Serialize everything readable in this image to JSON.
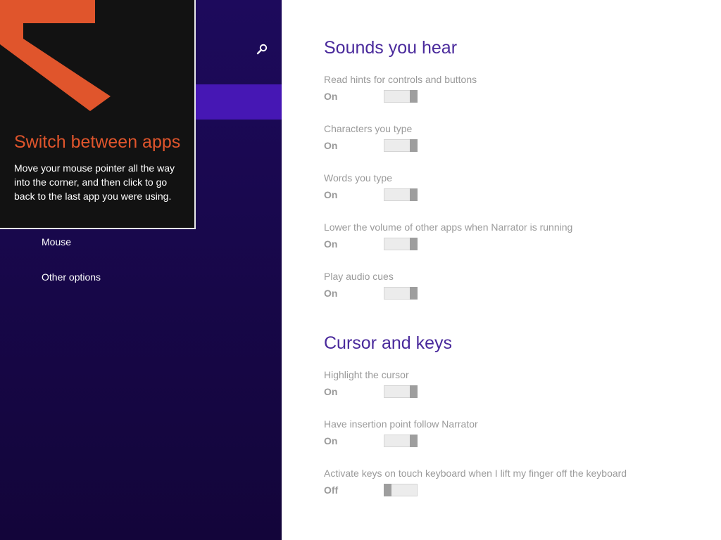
{
  "left_pane": {
    "nav_items": [
      "Mouse",
      "Other options"
    ]
  },
  "tip": {
    "title": "Switch between apps",
    "body": "Move your mouse pointer all the way into the corner, and then click to go back to the last app you were using."
  },
  "icons": {
    "search": "search-icon",
    "arrow": "corner-arrow-icon"
  },
  "colors": {
    "accent": "#4617b4",
    "pane_background": "#1d0a5c",
    "section_title": "#4a2a9c",
    "tip_title": "#e0552c",
    "arrow": "#e0552c"
  },
  "sections": [
    {
      "title": "Sounds you hear",
      "settings": [
        {
          "label": "Read hints for controls and buttons",
          "state": "On"
        },
        {
          "label": "Characters you type",
          "state": "On"
        },
        {
          "label": "Words you type",
          "state": "On"
        },
        {
          "label": "Lower the volume of other apps when Narrator is running",
          "state": "On"
        },
        {
          "label": "Play audio cues",
          "state": "On"
        }
      ]
    },
    {
      "title": "Cursor and keys",
      "settings": [
        {
          "label": "Highlight the cursor",
          "state": "On"
        },
        {
          "label": "Have insertion point follow Narrator",
          "state": "On"
        },
        {
          "label": "Activate keys on touch keyboard when I lift my finger off the keyboard",
          "state": "Off"
        }
      ]
    }
  ]
}
